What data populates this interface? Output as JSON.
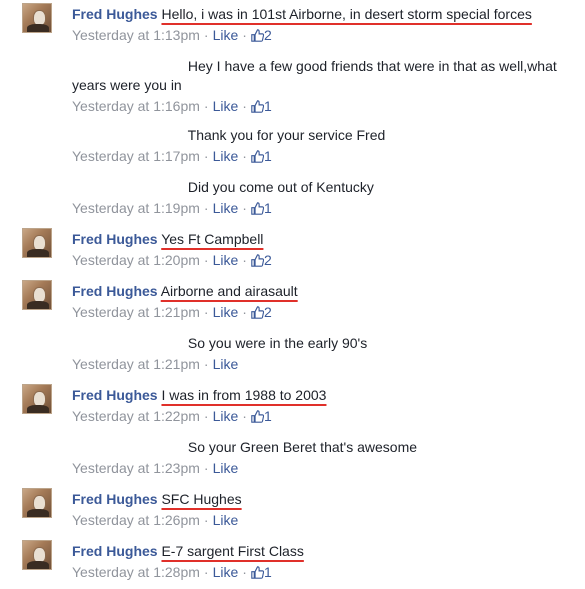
{
  "comments": [
    {
      "author": "Fred Hughes",
      "text": "Hello, i was in 101st Airborne, in desert storm special forces",
      "time": "Yesterday at 1:13pm",
      "like": "Like",
      "likes": "2"
    },
    {
      "author": "",
      "text": "Hey I have a few good friends that were in that as well,what years were you in",
      "time": "Yesterday at 1:16pm",
      "like": "Like",
      "likes": "1"
    },
    {
      "author": "",
      "text": "Thank you for your service Fred",
      "time": "Yesterday at 1:17pm",
      "like": "Like",
      "likes": "1"
    },
    {
      "author": "",
      "text": "Did you come out of Kentucky",
      "time": "Yesterday at 1:19pm",
      "like": "Like",
      "likes": "1"
    },
    {
      "author": "Fred Hughes",
      "text": "Yes Ft Campbell",
      "time": "Yesterday at 1:20pm",
      "like": "Like",
      "likes": "2"
    },
    {
      "author": "Fred Hughes",
      "text": "Airborne and airasault",
      "time": "Yesterday at 1:21pm",
      "like": "Like",
      "likes": "2"
    },
    {
      "author": "",
      "text": "So you were in the early 90's",
      "time": "Yesterday at 1:21pm",
      "like": "Like",
      "likes": ""
    },
    {
      "author": "Fred Hughes",
      "text": "I was in from 1988 to 2003",
      "time": "Yesterday at 1:22pm",
      "like": "Like",
      "likes": "1"
    },
    {
      "author": "",
      "text": "So your Green Beret that's awesome",
      "time": "Yesterday at 1:23pm",
      "like": "Like",
      "likes": ""
    },
    {
      "author": "Fred Hughes",
      "text": "SFC Hughes",
      "time": "Yesterday at 1:26pm",
      "like": "Like",
      "likes": ""
    },
    {
      "author": "Fred Hughes",
      "text": "E-7 sargent First Class",
      "time": "Yesterday at 1:28pm",
      "like": "Like",
      "likes": "1"
    }
  ],
  "icons": {
    "avatar": "profile-photo",
    "like_count": "thumbs-up-icon"
  },
  "colors": {
    "link": "#3b5998",
    "meta": "#90949c",
    "annotation": "#e0302a"
  }
}
